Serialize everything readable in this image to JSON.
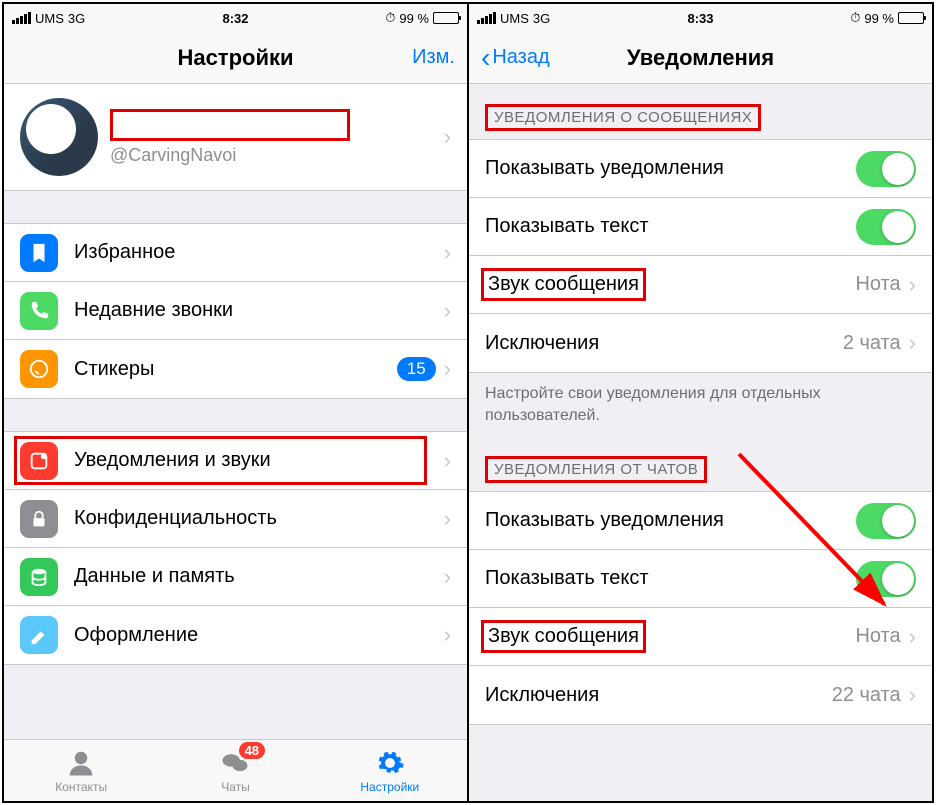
{
  "left": {
    "status": {
      "carrier": "UMS",
      "net": "3G",
      "time": "8:32",
      "battery": "99 %"
    },
    "nav": {
      "title": "Настройки",
      "edit": "Изм."
    },
    "profile": {
      "handle": "@CarvingNavoi"
    },
    "g1": {
      "favorites": "Избранное",
      "recent": "Недавние звонки",
      "stickers": "Стикеры",
      "stickers_badge": "15"
    },
    "g2": {
      "notifications": "Уведомления и звуки",
      "privacy": "Конфиденциальность",
      "data": "Данные и память",
      "appearance": "Оформление"
    },
    "tabs": {
      "contacts": "Контакты",
      "chats": "Чаты",
      "chats_badge": "48",
      "settings": "Настройки"
    }
  },
  "right": {
    "status": {
      "carrier": "UMS",
      "net": "3G",
      "time": "8:33",
      "battery": "99 %"
    },
    "nav": {
      "back": "Назад",
      "title": "Уведомления"
    },
    "s1": {
      "header": "УВЕДОМЛЕНИЯ О СООБЩЕНИЯХ",
      "show": "Показывать уведомления",
      "text": "Показывать текст",
      "sound": "Звук сообщения",
      "sound_val": "Нота",
      "except": "Исключения",
      "except_val": "2 чата",
      "footer": "Настройте свои уведомления для отдельных пользователей."
    },
    "s2": {
      "header": "УВЕДОМЛЕНИЯ ОТ ЧАТОВ",
      "show": "Показывать уведомления",
      "text": "Показывать текст",
      "sound": "Звук сообщения",
      "sound_val": "Нота",
      "except": "Исключения",
      "except_val": "22 чата"
    }
  }
}
